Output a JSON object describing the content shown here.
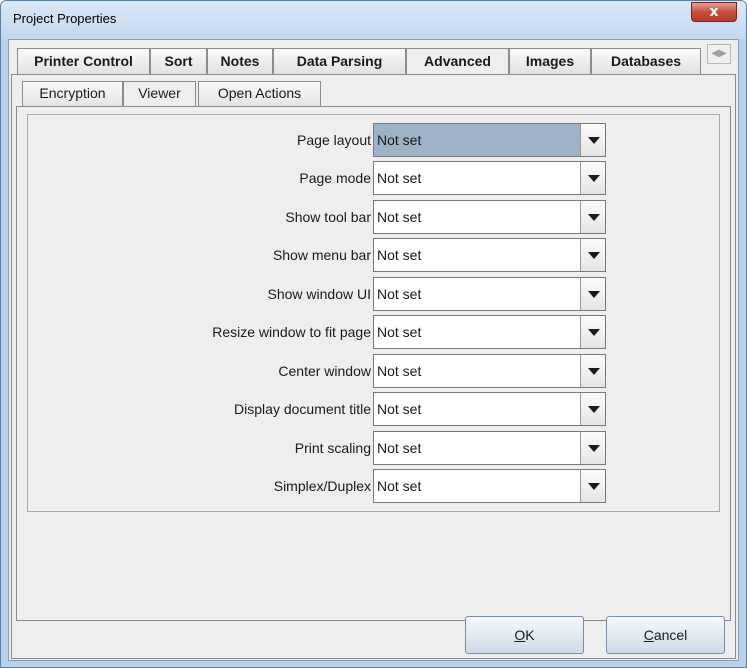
{
  "window": {
    "title": "Project Properties",
    "close_label": "x"
  },
  "tabs": [
    {
      "label": "Printer Control",
      "active": false
    },
    {
      "label": "Sort",
      "active": false
    },
    {
      "label": "Notes",
      "active": false
    },
    {
      "label": "Data Parsing",
      "active": false
    },
    {
      "label": "Advanced",
      "active": true
    },
    {
      "label": "Images",
      "active": false
    },
    {
      "label": "Databases",
      "active": false
    }
  ],
  "tab_scroll": {
    "left": "◀",
    "right": "▶"
  },
  "subtabs": [
    {
      "label": "Encryption",
      "active": false
    },
    {
      "label": "Viewer",
      "active": true
    },
    {
      "label": "Open Actions",
      "active": false
    }
  ],
  "viewer_settings": [
    {
      "label": "Page layout",
      "value": "Not set",
      "selected": true
    },
    {
      "label": "Page mode",
      "value": "Not set"
    },
    {
      "label": "Show tool bar",
      "value": "Not set"
    },
    {
      "label": "Show menu bar",
      "value": "Not set"
    },
    {
      "label": "Show window UI",
      "value": "Not set"
    },
    {
      "label": "Resize window to fit page",
      "value": "Not set"
    },
    {
      "label": "Center window",
      "value": "Not set"
    },
    {
      "label": "Display document title",
      "value": "Not set"
    },
    {
      "label": "Print scaling",
      "value": "Not set"
    },
    {
      "label": "Simplex/Duplex",
      "value": "Not set"
    }
  ],
  "buttons": {
    "ok_mnemonic": "O",
    "ok_rest": "K",
    "cancel_mnemonic": "C",
    "cancel_rest": "ancel"
  },
  "colors": {
    "selected_combo": "#9eb2c8",
    "window_frame": "#b9d1ea",
    "close_button": "#c74f3d"
  }
}
